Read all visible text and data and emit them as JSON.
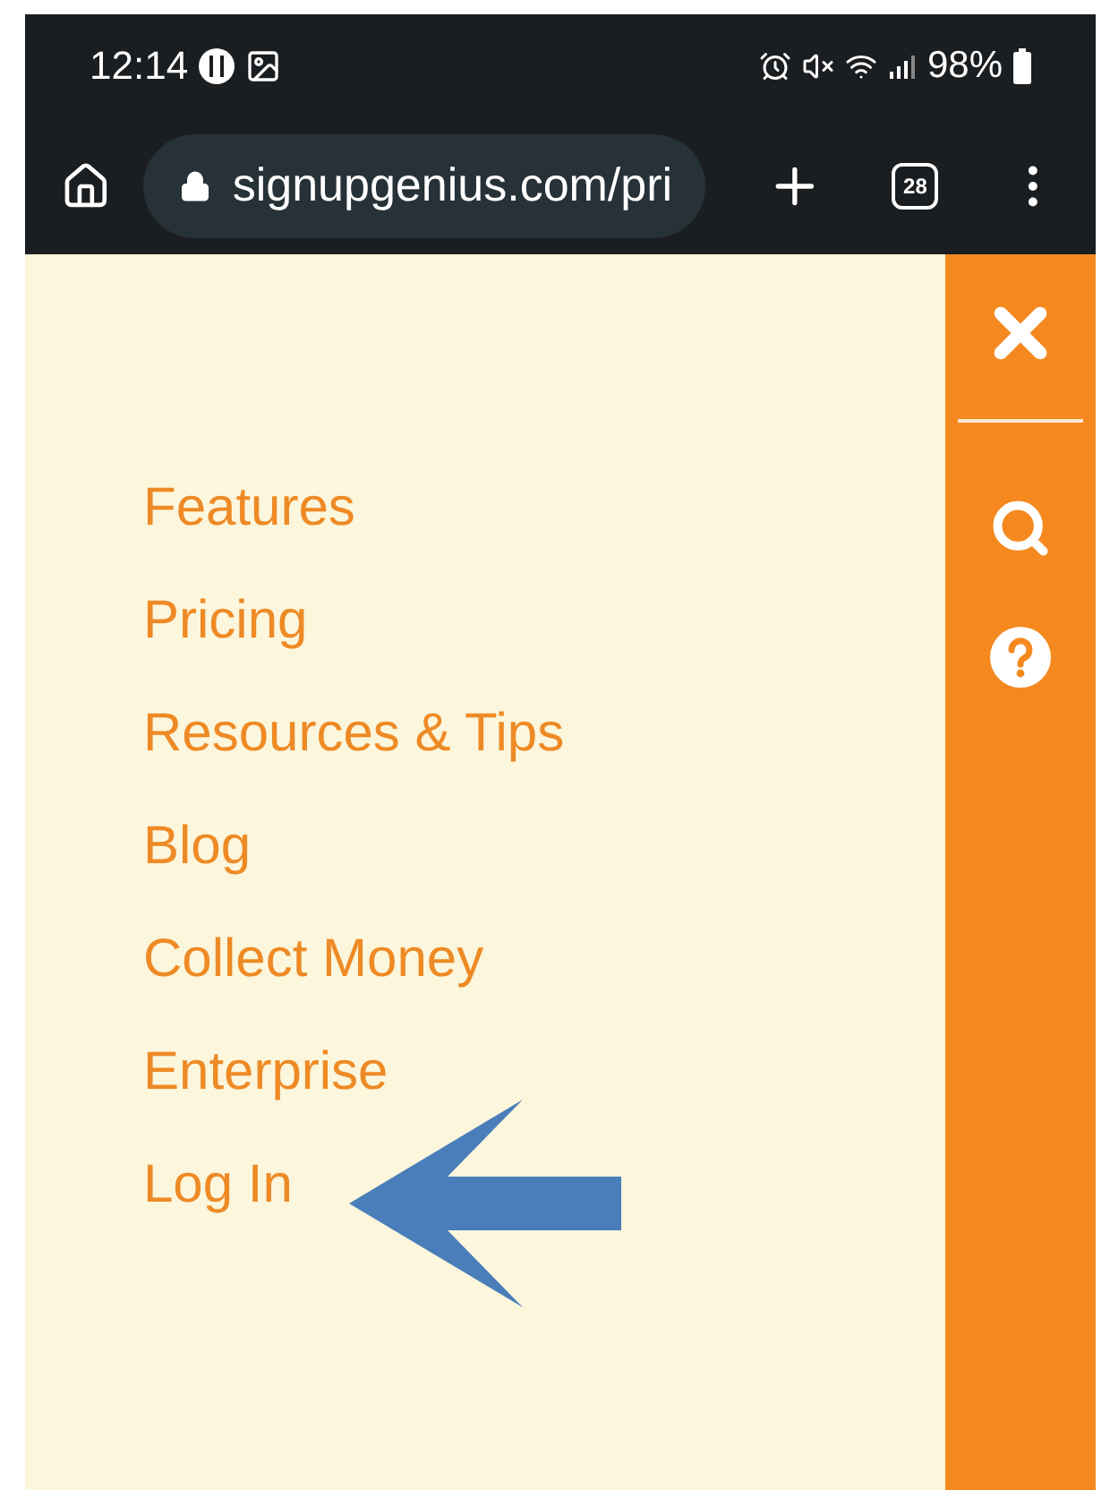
{
  "status_bar": {
    "time": "12:14",
    "battery": "98%"
  },
  "browser": {
    "url": "signupgenius.com/pri",
    "tab_count": "28"
  },
  "menu": {
    "items": [
      {
        "label": "Features"
      },
      {
        "label": "Pricing"
      },
      {
        "label": "Resources & Tips"
      },
      {
        "label": "Blog"
      },
      {
        "label": "Collect Money"
      },
      {
        "label": "Enterprise"
      },
      {
        "label": "Log In"
      }
    ]
  }
}
